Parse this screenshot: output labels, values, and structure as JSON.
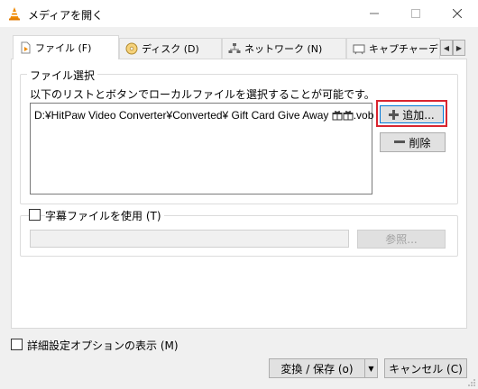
{
  "window": {
    "title": "メディアを開く",
    "minimize_symbol": "—",
    "close_symbol": "✕"
  },
  "tabs": [
    {
      "label": "ファイル (F)",
      "icon": "file-play-icon",
      "active": true
    },
    {
      "label": "ディスク (D)",
      "icon": "disc-icon",
      "active": false
    },
    {
      "label": "ネットワーク (N)",
      "icon": "network-icon",
      "active": false
    },
    {
      "label": "キャプチャーデ",
      "icon": "capture-icon",
      "active": false
    }
  ],
  "tab_scroll": {
    "left": "◀",
    "right": "▶"
  },
  "file_group": {
    "title": "ファイル選択",
    "hint": "以下のリストとボタンでローカルファイルを選択することが可能です。",
    "files": [
      "D:¥HitPaw Video Converter¥Converted¥ Gift Card Give Away ",
      ".vob"
    ],
    "add_button": "追加...",
    "remove_button": "削除"
  },
  "subtitle_group": {
    "checkbox_label": "字幕ファイルを使用 (T)",
    "checked": false,
    "path_value": "",
    "browse_button": "参照..."
  },
  "advanced_options": {
    "checkbox_label": "詳細設定オプションの表示 (M)",
    "checked": false
  },
  "footer": {
    "convert_button": "変換 / 保存 (o)",
    "dropdown_arrow": "▼",
    "cancel_button": "キャンセル (C)"
  },
  "colors": {
    "highlight": "#d9252f",
    "focus": "#0078d7",
    "vlc_orange": "#f08a00"
  }
}
